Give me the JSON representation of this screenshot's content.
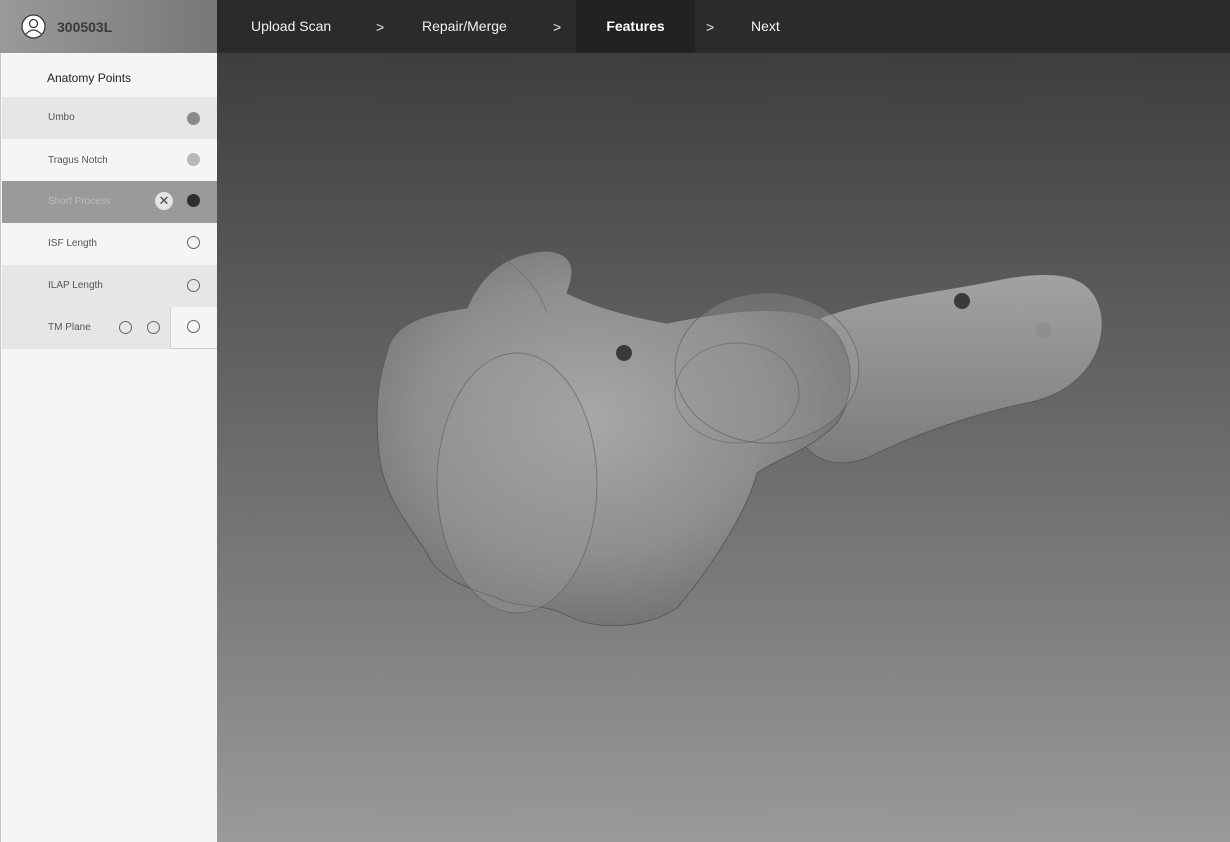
{
  "header": {
    "patient_id": "300503L",
    "steps": [
      {
        "label": "Upload Scan"
      },
      {
        "label": "Repair/Merge"
      },
      {
        "label": "Features"
      },
      {
        "label": "Next"
      }
    ],
    "separator": ">"
  },
  "sidebar": {
    "title": "Anatomy Points",
    "items": [
      {
        "label": "Umbo",
        "marker": "filled",
        "color": "#8a8a8a"
      },
      {
        "label": "Tragus Notch",
        "marker": "filled",
        "color": "#b8b8b8"
      },
      {
        "label": "Short Process",
        "marker": "filled",
        "color": "#2e2e2e",
        "selected": true
      },
      {
        "label": "ISF Length",
        "marker": "empty"
      },
      {
        "label": "ILAP Length",
        "marker": "empty"
      },
      {
        "label": "TM Plane",
        "marker": "empty"
      }
    ],
    "clear_icon": "x-icon"
  },
  "colors": {
    "topbar": "#2b2b2b",
    "selected_row": "#9a9a9a",
    "sidebar_bg": "#f5f5f5"
  }
}
